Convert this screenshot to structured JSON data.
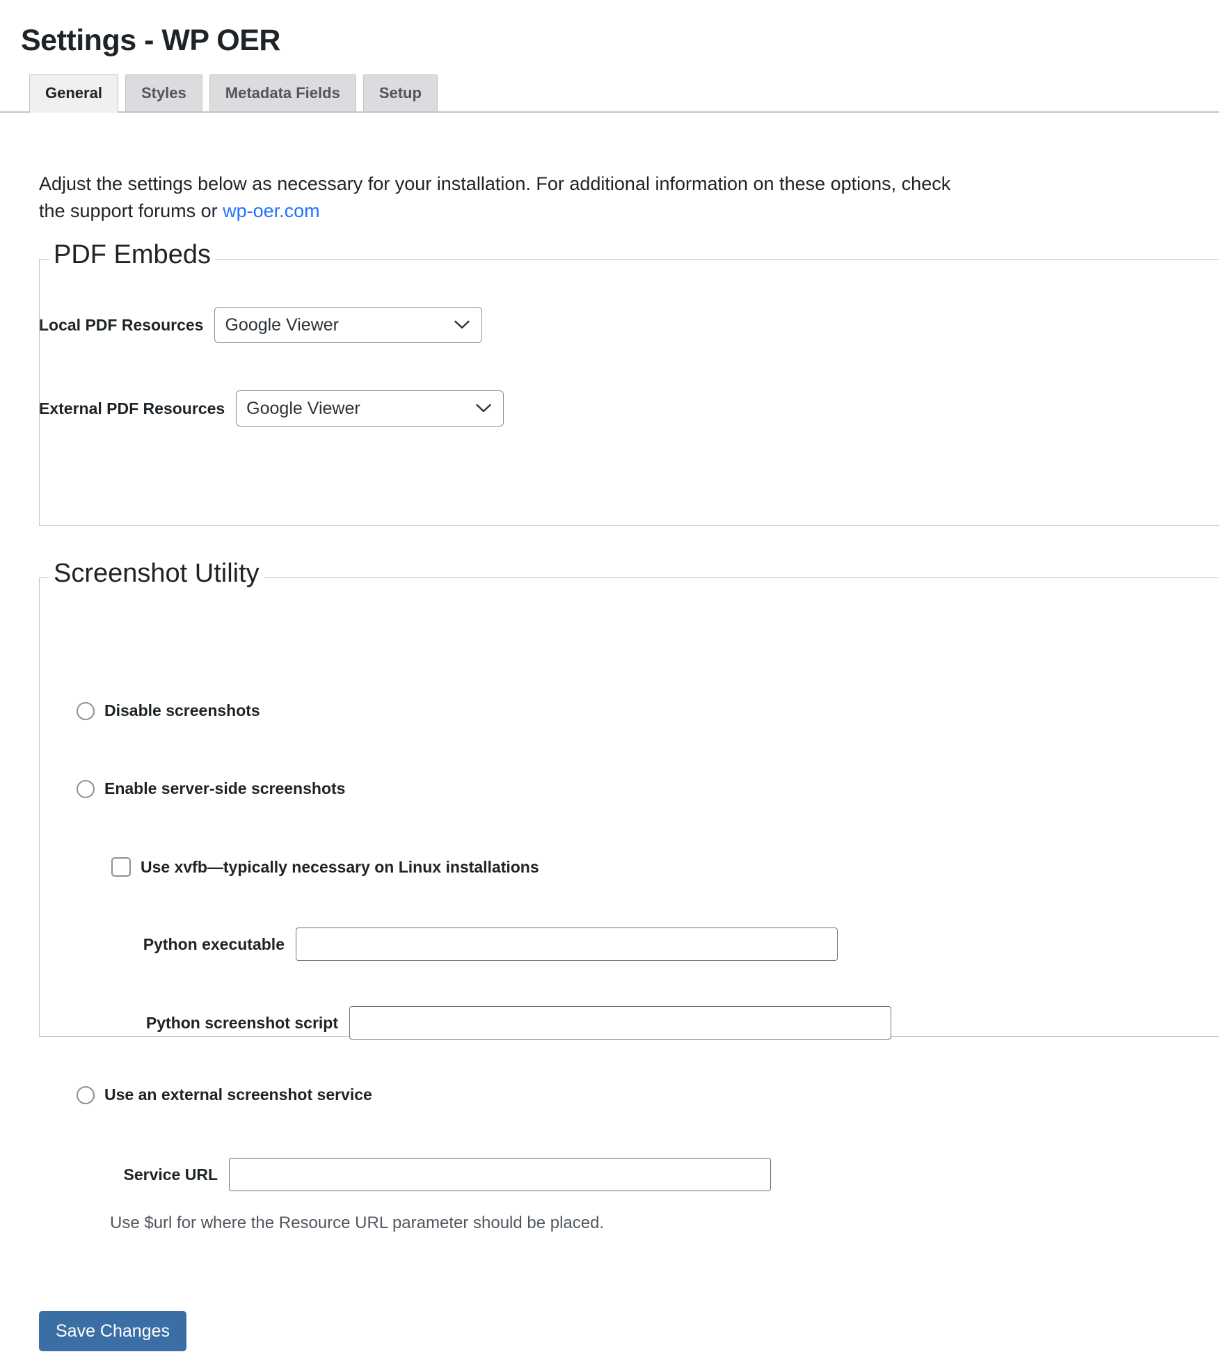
{
  "page_title": "Settings - WP OER",
  "tabs": [
    {
      "label": "General",
      "active": true
    },
    {
      "label": "Styles",
      "active": false
    },
    {
      "label": "Metadata Fields",
      "active": false
    },
    {
      "label": "Setup",
      "active": false
    }
  ],
  "intro": {
    "text_before": "Adjust the settings below as necessary for your installation. For additional information on these options, check the support forums or ",
    "link_text": "wp-oer.com",
    "link_color": "#2271ff"
  },
  "pdf_embeds": {
    "legend": "PDF Embeds",
    "local": {
      "label": "Local PDF Resources",
      "value": "Google Viewer",
      "options": [
        "Google Viewer"
      ]
    },
    "external": {
      "label": "External PDF Resources",
      "value": "Google Viewer",
      "options": [
        "Google Viewer"
      ]
    }
  },
  "screenshot_utility": {
    "legend": "Screenshot Utility",
    "option_disable": {
      "label": "Disable screenshots",
      "selected": false
    },
    "option_server": {
      "label": "Enable server-side screenshots",
      "selected": false
    },
    "xvfb": {
      "label": "Use xvfb—typically necessary on Linux installations",
      "checked": false
    },
    "python_executable": {
      "label": "Python executable",
      "value": ""
    },
    "python_script": {
      "label": "Python screenshot script",
      "value": ""
    },
    "option_external": {
      "label": "Use an external screenshot service",
      "selected": false
    },
    "service_url": {
      "label": "Service URL",
      "value": ""
    },
    "service_url_help": "Use $url for where the Resource URL parameter should be placed."
  },
  "save_button": {
    "label": "Save Changes",
    "color": "#3a6ea5"
  }
}
